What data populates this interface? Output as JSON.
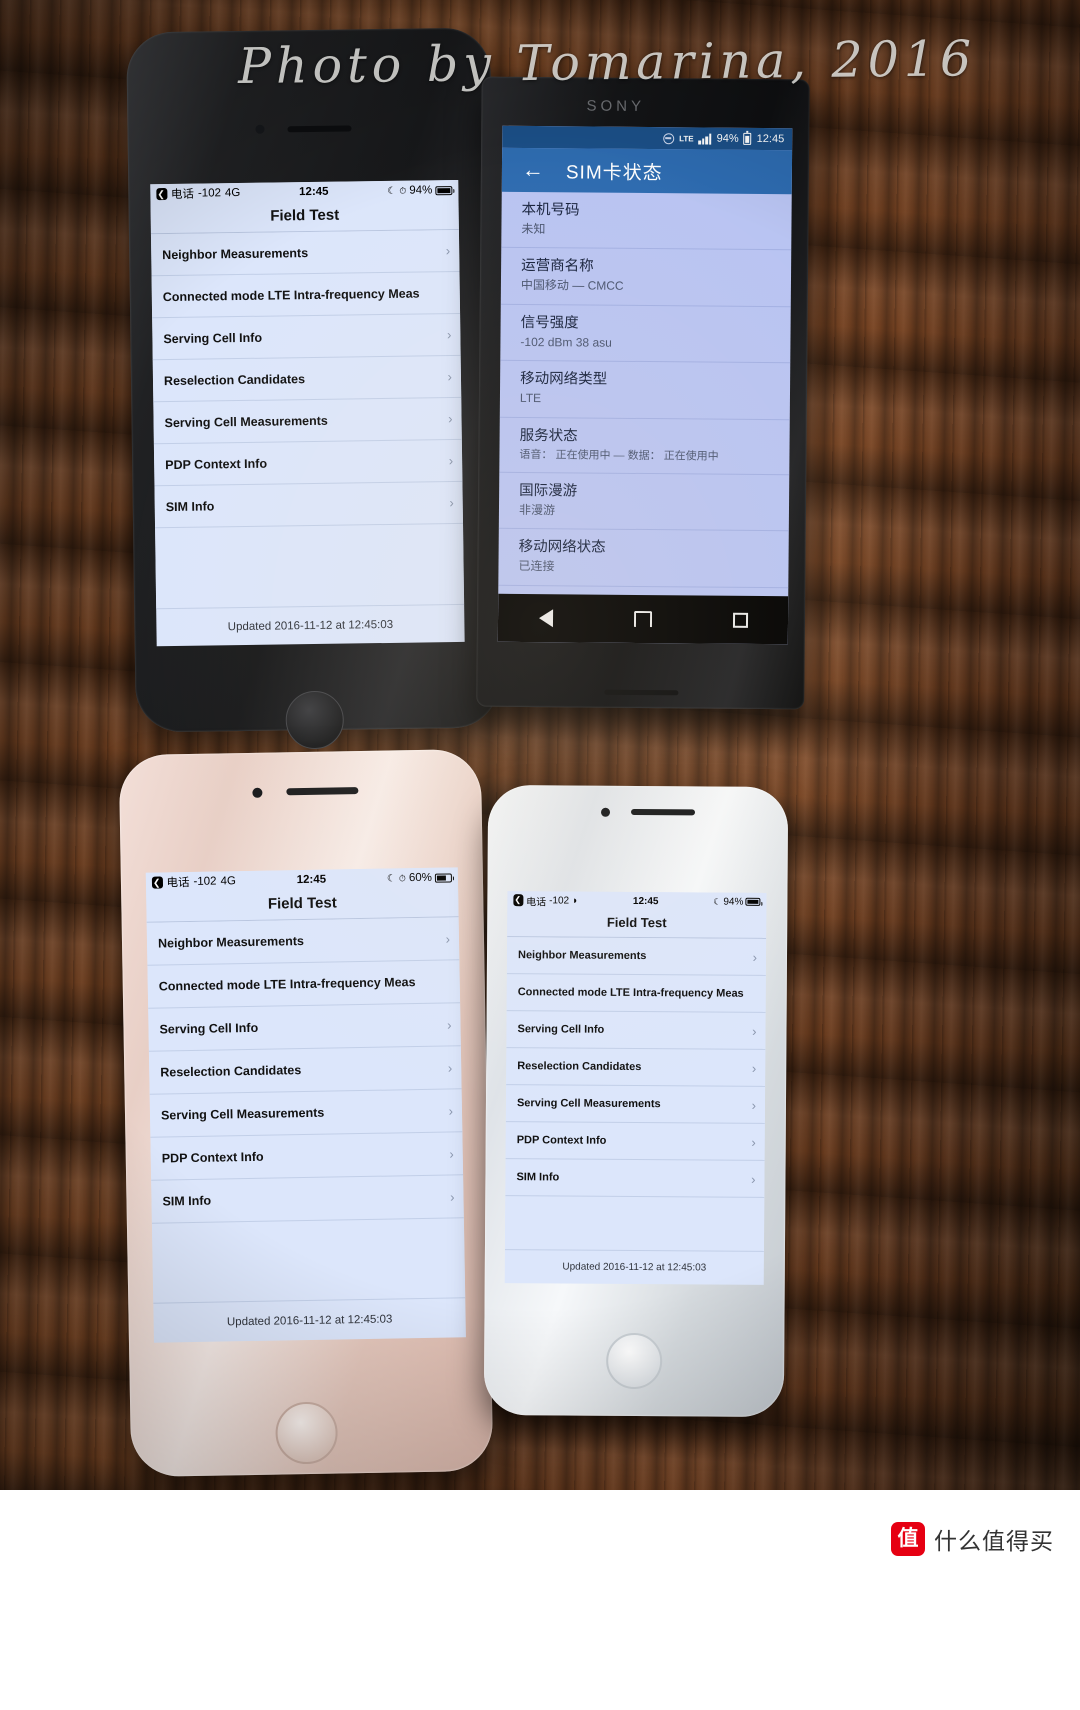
{
  "photo": {
    "watermark": "Photo by Tomarina, 2016",
    "site_badge": "值",
    "site_name": "什么值得买"
  },
  "phones": {
    "top_left_iphone": {
      "name": "iPhone black Field Test",
      "status_bar": {
        "back_glyph": "❮",
        "carrier_label": "电话",
        "signal_value": "-102",
        "network": "4G",
        "time": "12:45",
        "moon_icon": "☾",
        "alarm_icon": "⏰",
        "battery_pct": "94%",
        "battery_level": 94
      },
      "title": "Field Test",
      "rows": [
        "Neighbor Measurements",
        "Connected mode LTE Intra-frequency Meas",
        "Serving Cell Info",
        "Reselection Candidates",
        "Serving Cell Measurements",
        "PDP Context Info",
        "SIM Info"
      ],
      "chevron": "›",
      "footer": "Updated 2016-11-12 at 12:45:03"
    },
    "sony_android": {
      "brand": "SONY",
      "status_bar": {
        "lte_label": "LTE",
        "battery_pct": "94%",
        "time": "12:45"
      },
      "app_bar": {
        "back_glyph": "←",
        "title": "SIM卡状态"
      },
      "items": [
        {
          "label": "本机号码",
          "value": "未知"
        },
        {
          "label": "运营商名称",
          "value": "中国移动 — CMCC"
        },
        {
          "label": "信号强度",
          "value": "-102 dBm 38 asu"
        },
        {
          "label": "移动网络类型",
          "value": "LTE"
        },
        {
          "label": "服务状态",
          "value": "语音： 正在使用中 — 数据： 正在使用中"
        },
        {
          "label": "国际漫游",
          "value": "非漫游"
        },
        {
          "label": "移动网络状态",
          "value": "已连接"
        }
      ],
      "nav": {
        "back": "back-triangle",
        "home": "home",
        "recents": "square"
      }
    },
    "bottom_left_iphone": {
      "name": "iPhone rose gold Field Test",
      "status_bar": {
        "back_glyph": "❮",
        "carrier_label": "电话",
        "signal_value": "-102",
        "network": "4G",
        "time": "12:45",
        "moon_icon": "☾",
        "alarm_icon": "⏰",
        "battery_pct": "60%",
        "battery_level": 60
      },
      "title": "Field Test",
      "rows": [
        "Neighbor Measurements",
        "Connected mode LTE Intra-frequency Meas",
        "Serving Cell Info",
        "Reselection Candidates",
        "Serving Cell Measurements",
        "PDP Context Info",
        "SIM Info"
      ],
      "chevron": "›",
      "footer": "Updated 2016-11-12 at 12:45:03"
    },
    "bottom_right_iphone": {
      "name": "iPhone silver Field Test",
      "status_bar": {
        "back_glyph": "❮",
        "carrier_label": "电话",
        "signal_value": "-102",
        "network": "wifi",
        "time": "12:45",
        "moon_icon": "☾",
        "battery_pct": "94%",
        "battery_level": 94
      },
      "title": "Field Test",
      "rows": [
        "Neighbor Measurements",
        "Connected mode LTE Intra-frequency Meas",
        "Serving Cell Info",
        "Reselection Candidates",
        "Serving Cell Measurements",
        "PDP Context Info",
        "SIM Info"
      ],
      "chevron": "›",
      "footer": "Updated 2016-11-12 at 12:45:03"
    }
  },
  "colors": {
    "ios_screen_bg": "#dce6fb",
    "android_appbar": "#2d6bb0",
    "android_statusbar": "#1b4f87",
    "android_list_bg": "#b9c4f2",
    "brand_red": "#e60012"
  }
}
